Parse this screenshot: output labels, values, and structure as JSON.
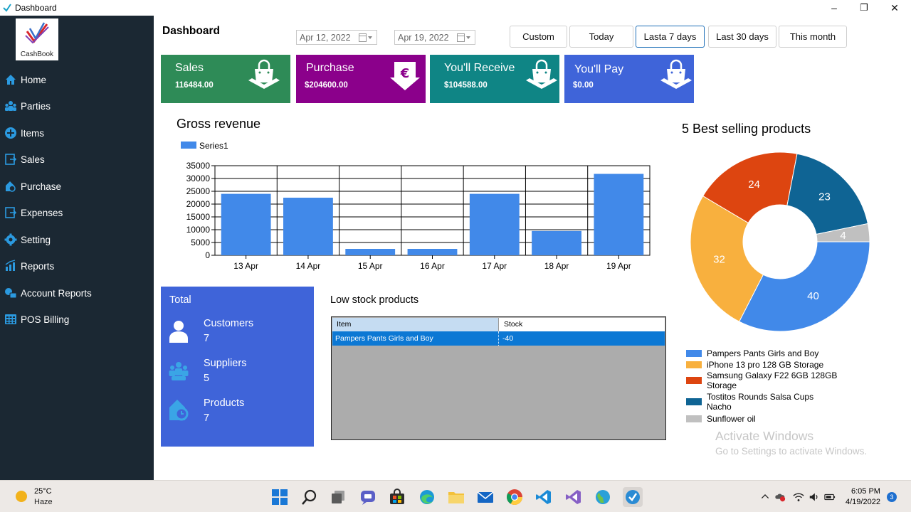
{
  "window": {
    "title": "Dashboard",
    "minimize": "–",
    "maximize": "❐",
    "close": "✕"
  },
  "logo": {
    "text": "CashBook"
  },
  "sidebar": {
    "items": [
      {
        "label": "Home",
        "icon": "home-icon"
      },
      {
        "label": "Parties",
        "icon": "parties-icon"
      },
      {
        "label": "Items",
        "icon": "plus-circle-icon"
      },
      {
        "label": "Sales",
        "icon": "sales-icon"
      },
      {
        "label": "Purchase",
        "icon": "purchase-icon"
      },
      {
        "label": "Expenses",
        "icon": "expenses-icon"
      },
      {
        "label": "Setting",
        "icon": "gear-icon"
      },
      {
        "label": "Reports",
        "icon": "reports-icon"
      },
      {
        "label": "Account Reports",
        "icon": "account-reports-icon"
      },
      {
        "label": "POS Billing",
        "icon": "pos-billing-icon"
      }
    ]
  },
  "header": {
    "title": "Dashboard",
    "date_from": "Apr  12, 2022",
    "date_to": "Apr  19, 2022",
    "ranges": [
      "Custom",
      "Today",
      "Lasta 7 days",
      "Last 30 days",
      "This month"
    ],
    "active_range": "Lasta 7 days"
  },
  "cards": [
    {
      "label": "Sales",
      "value": "116484.00",
      "color": "#2e8b57",
      "icon": "shopping-bag-icon"
    },
    {
      "label": "Purchase",
      "value": "$204600.00",
      "color": "#8b008b",
      "icon": "euro-down-icon"
    },
    {
      "label": "You'll Receive",
      "value": "$104588.00",
      "color": "#0f8585",
      "icon": "shopping-bag-icon"
    },
    {
      "label": "You'll Pay",
      "value": "$0.00",
      "color": "#3f64d9",
      "icon": "shopping-bag-icon"
    }
  ],
  "chart_data": [
    {
      "type": "bar",
      "title": "Gross revenue",
      "categories": [
        "13 Apr",
        "14 Apr",
        "15 Apr",
        "16 Apr",
        "17 Apr",
        "18 Apr",
        "19 Apr"
      ],
      "series": [
        {
          "name": "Series1",
          "values": [
            24000,
            22500,
            2500,
            2500,
            24000,
            9500,
            31800
          ],
          "color": "#4189e9"
        }
      ],
      "ylim": [
        0,
        35000
      ],
      "yticks": [
        0,
        5000,
        10000,
        15000,
        20000,
        25000,
        30000,
        35000
      ],
      "grid": true,
      "legend": "top-left"
    },
    {
      "type": "pie",
      "title": "5 Best selling products",
      "slices": [
        {
          "label": "Pampers Pants Girls and Boy",
          "value": 40,
          "color": "#4189e9"
        },
        {
          "label": "iPhone 13 pro 128 GB Storage",
          "value": 32,
          "color": "#f8b03e"
        },
        {
          "label": "Samsung Galaxy F22 6GB 128GB Storage",
          "value": 24,
          "color": "#dd4510"
        },
        {
          "label": "Tostitos Rounds Salsa Cups Nacho",
          "value": 23,
          "color": "#0f6494"
        },
        {
          "label": "Sunflower oil",
          "value": 4,
          "color": "#c0c0c0"
        }
      ],
      "legend": "bottom"
    }
  ],
  "totals": {
    "title": "Total",
    "items": [
      {
        "label": "Customers",
        "value": "7",
        "icon": "customer-icon"
      },
      {
        "label": "Suppliers",
        "value": "5",
        "icon": "suppliers-icon"
      },
      {
        "label": "Products",
        "value": "7",
        "icon": "products-icon"
      }
    ]
  },
  "low_stock": {
    "title": "Low stock products",
    "columns": [
      "Item",
      "Stock"
    ],
    "rows": [
      {
        "item": "Pampers Pants Girls and Boy",
        "stock": "-40"
      }
    ]
  },
  "watermark": {
    "line1": "Activate Windows",
    "line2": "Go to Settings to activate Windows."
  },
  "taskbar": {
    "weather_temp": "25°C",
    "weather_desc": "Haze",
    "time": "6:05 PM",
    "date": "4/19/2022",
    "notification_count": "3"
  }
}
